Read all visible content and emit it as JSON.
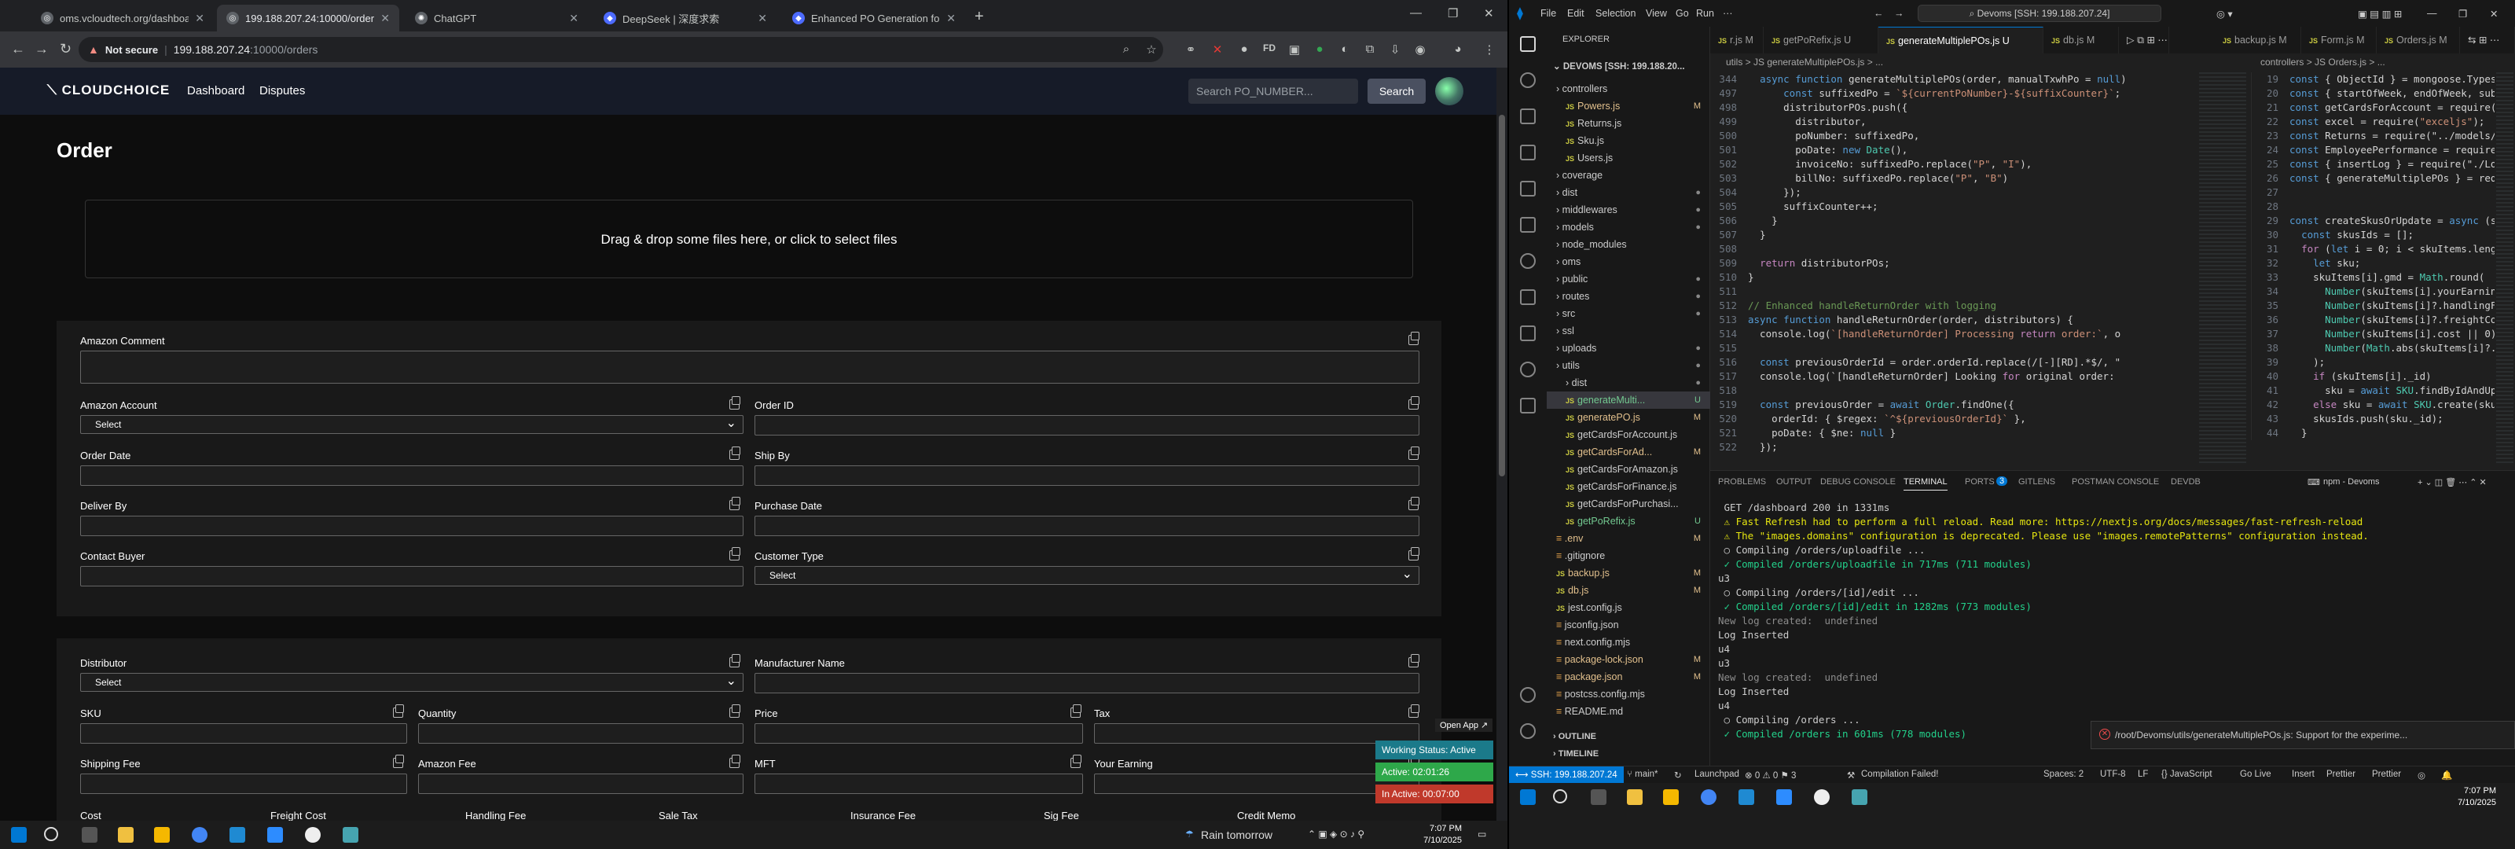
{
  "browser": {
    "tabs": [
      {
        "title": "oms.vcloudtech.org/dashboard",
        "fav": "◎"
      },
      {
        "title": "199.188.207.24:10000/orders",
        "fav": "◎"
      },
      {
        "title": "ChatGPT",
        "fav": "✺"
      },
      {
        "title": "DeepSeek | 深度求索",
        "fav": "◆"
      },
      {
        "title": "Enhanced PO Generation for M",
        "fav": "◆"
      }
    ],
    "url_security": "Not secure",
    "url_host": "199.188.207.24",
    "url_path": ":10000/orders"
  },
  "site": {
    "logo": "CLOUDCHOICE",
    "nav": [
      "Dashboard",
      "Disputes"
    ],
    "search_placeholder": "Search PO_NUMBER...",
    "search_button": "Search"
  },
  "form": {
    "title": "Order",
    "dropzone": "Drag & drop some files here, or click to select files",
    "amazon_comment": "Amazon Comment",
    "amazon_account": "Amazon Account",
    "order_id": "Order ID",
    "order_date": "Order Date",
    "ship_by": "Ship By",
    "deliver_by": "Deliver By",
    "purchase_date": "Purchase Date",
    "contact_buyer": "Contact Buyer",
    "customer_type": "Customer Type",
    "distributor": "Distributor",
    "manufacturer_name": "Manufacturer Name",
    "sku": "SKU",
    "quantity": "Quantity",
    "price": "Price",
    "tax": "Tax",
    "shipping_fee": "Shipping Fee",
    "amazon_fee": "Amazon Fee",
    "mft": "MFT",
    "your_earning": "Your Earning",
    "cost": "Cost",
    "freight_cost": "Freight Cost",
    "handling_fee": "Handling Fee",
    "sale_tax": "Sale Tax",
    "insurance_fee": "Insurance Fee",
    "sig_fee": "Sig Fee",
    "credit_memo": "Credit Memo",
    "select": "Select"
  },
  "overlay": {
    "open_app": "Open App ↗",
    "working_status": "Working Status: Active",
    "active": "Active: 02:01:26",
    "inactive": "In Active: 00:07:00",
    "colors": {
      "working": "#1b7a8a",
      "active": "#2ea84a",
      "inactive": "#c0392b"
    }
  },
  "win_taskbar_left": {
    "weather": "Rain tomorrow",
    "time": "7:07 PM",
    "date": "7/10/2025"
  },
  "vscode": {
    "menu": [
      "File",
      "Edit",
      "Selection",
      "View",
      "Go",
      "Run",
      "···"
    ],
    "command_center": "Devoms [SSH: 199.188.207.24]",
    "explorer_label": "EXPLORER",
    "root": "DEVOMS [SSH: 199.188.20...",
    "tree": [
      {
        "name": "controllers",
        "indent": 1,
        "folder": true,
        "mark": ""
      },
      {
        "name": "Powers.js",
        "indent": 2,
        "js": true,
        "mark": "M"
      },
      {
        "name": "Returns.js",
        "indent": 2,
        "js": true,
        "mark": ""
      },
      {
        "name": "Sku.js",
        "indent": 2,
        "js": true,
        "mark": ""
      },
      {
        "name": "Users.js",
        "indent": 2,
        "js": true,
        "mark": ""
      },
      {
        "name": "coverage",
        "indent": 1,
        "folder": true,
        "mark": ""
      },
      {
        "name": "dist",
        "indent": 1,
        "folder": true,
        "mark": "●"
      },
      {
        "name": "middlewares",
        "indent": 1,
        "folder": true,
        "mark": "●"
      },
      {
        "name": "models",
        "indent": 1,
        "folder": true,
        "mark": "●"
      },
      {
        "name": "node_modules",
        "indent": 1,
        "folder": true,
        "mark": ""
      },
      {
        "name": "oms",
        "indent": 1,
        "folder": true,
        "mark": ""
      },
      {
        "name": "public",
        "indent": 1,
        "folder": true,
        "mark": "●"
      },
      {
        "name": "routes",
        "indent": 1,
        "folder": true,
        "mark": "●"
      },
      {
        "name": "src",
        "indent": 1,
        "folder": true,
        "mark": "●"
      },
      {
        "name": "ssl",
        "indent": 1,
        "folder": true,
        "mark": ""
      },
      {
        "name": "uploads",
        "indent": 1,
        "folder": true,
        "mark": "●"
      },
      {
        "name": "utils",
        "indent": 1,
        "folder": true,
        "mark": "●"
      },
      {
        "name": "dist",
        "indent": 2,
        "folder": true,
        "mark": "●"
      },
      {
        "name": "generateMulti...",
        "indent": 2,
        "js": true,
        "mark": "U",
        "selected": true
      },
      {
        "name": "generatePO.js",
        "indent": 2,
        "js": true,
        "mark": "M"
      },
      {
        "name": "getCardsForAccount.js",
        "indent": 2,
        "js": true,
        "mark": ""
      },
      {
        "name": "getCardsForAd...",
        "indent": 2,
        "js": true,
        "mark": "M"
      },
      {
        "name": "getCardsForAmazon.js",
        "indent": 2,
        "js": true,
        "mark": ""
      },
      {
        "name": "getCardsForFinance.js",
        "indent": 2,
        "js": true,
        "mark": ""
      },
      {
        "name": "getCardsForPurchasi...",
        "indent": 2,
        "js": true,
        "mark": ""
      },
      {
        "name": "getPoRefix.js",
        "indent": 2,
        "js": true,
        "mark": "U"
      },
      {
        "name": ".env",
        "indent": 1,
        "js": false,
        "mark": "M"
      },
      {
        "name": ".gitignore",
        "indent": 1,
        "js": false,
        "mark": ""
      },
      {
        "name": "backup.js",
        "indent": 1,
        "js": true,
        "mark": "M"
      },
      {
        "name": "db.js",
        "indent": 1,
        "js": true,
        "mark": "M"
      },
      {
        "name": "jest.config.js",
        "indent": 1,
        "js": true,
        "mark": ""
      },
      {
        "name": "jsconfig.json",
        "indent": 1,
        "js": false,
        "mark": ""
      },
      {
        "name": "next.config.mjs",
        "indent": 1,
        "js": false,
        "mark": ""
      },
      {
        "name": "package-lock.json",
        "indent": 1,
        "js": false,
        "mark": "M"
      },
      {
        "name": "package.json",
        "indent": 1,
        "js": false,
        "mark": "M"
      },
      {
        "name": "postcss.config.mjs",
        "indent": 1,
        "js": false,
        "mark": ""
      },
      {
        "name": "README.md",
        "indent": 1,
        "js": false,
        "mark": ""
      }
    ],
    "outline": "OUTLINE",
    "timeline": "TIMELINE",
    "editor_tabs": [
      "r.js M",
      "getPoRefix.js U",
      "generateMultiplePOs.js U",
      "db.js M",
      "backup.js M",
      "Form.js M",
      "Orders.js M"
    ],
    "crumbs_left": "utils > JS generateMultiplePOs.js > ...",
    "crumbs_right": "controllers > JS Orders.js > ...",
    "left_lines": [
      {
        "n": "344",
        "t": "  async function generateMultiplePOs(order, manualTxwhPo = null)"
      },
      {
        "n": "497",
        "t": "      const suffixedPo = `${currentPoNumber}-${suffixCounter}`;"
      },
      {
        "n": "498",
        "t": "      distributorPOs.push({"
      },
      {
        "n": "499",
        "t": "        distributor,"
      },
      {
        "n": "500",
        "t": "        poNumber: suffixedPo,"
      },
      {
        "n": "501",
        "t": "        poDate: new Date(),"
      },
      {
        "n": "502",
        "t": "        invoiceNo: suffixedPo.replace(\"P\", \"I\"),"
      },
      {
        "n": "503",
        "t": "        billNo: suffixedPo.replace(\"P\", \"B\")"
      },
      {
        "n": "504",
        "t": "      });"
      },
      {
        "n": "505",
        "t": "      suffixCounter++;"
      },
      {
        "n": "506",
        "t": "    }"
      },
      {
        "n": "507",
        "t": "  }"
      },
      {
        "n": "508",
        "t": ""
      },
      {
        "n": "509",
        "t": "  return distributorPOs;"
      },
      {
        "n": "510",
        "t": "}"
      },
      {
        "n": "511",
        "t": ""
      },
      {
        "n": "512",
        "t": "// Enhanced handleReturnOrder with logging"
      },
      {
        "n": "513",
        "t": "async function handleReturnOrder(order, distributors) {"
      },
      {
        "n": "514",
        "t": "  console.log(`[handleReturnOrder] Processing return order:`, o"
      },
      {
        "n": "515",
        "t": ""
      },
      {
        "n": "516",
        "t": "  const previousOrderId = order.orderId.replace(/[-][RD].*$/, \""
      },
      {
        "n": "517",
        "t": "  console.log(`[handleReturnOrder] Looking for original order:"
      },
      {
        "n": "518",
        "t": ""
      },
      {
        "n": "519",
        "t": "  const previousOrder = await Order.findOne({"
      },
      {
        "n": "520",
        "t": "    orderId: { $regex: `^${previousOrderId}` },"
      },
      {
        "n": "521",
        "t": "    poDate: { $ne: null }"
      },
      {
        "n": "522",
        "t": "  });"
      }
    ],
    "right_lines": [
      {
        "n": "19",
        "t": "const { ObjectId } = mongoose.Types;"
      },
      {
        "n": "20",
        "t": "const { startOfWeek, endOfWeek, subWe"
      },
      {
        "n": "21",
        "t": "const getCardsForAccount = require(\"."
      },
      {
        "n": "22",
        "t": "const excel = require(\"exceljs\");"
      },
      {
        "n": "23",
        "t": "const Returns = require(\"../models/Re"
      },
      {
        "n": "24",
        "t": "const EmployeePerformance = require(\""
      },
      {
        "n": "25",
        "t": "const { insertLog } = require(\"./Log"
      },
      {
        "n": "26",
        "t": "const { generateMultiplePOs } = requi"
      },
      {
        "n": "27",
        "t": ""
      },
      {
        "n": "28",
        "t": ""
      },
      {
        "n": "29",
        "t": "const createSkusOrUpdate = async (sku"
      },
      {
        "n": "30",
        "t": "  const skusIds = [];"
      },
      {
        "n": "31",
        "t": "  for (let i = 0; i < skuItems.length"
      },
      {
        "n": "32",
        "t": "    let sku;"
      },
      {
        "n": "33",
        "t": "    skuItems[i].gmd = Math.round("
      },
      {
        "n": "34",
        "t": "      Number(skuItems[i].yourEarnin"
      },
      {
        "n": "35",
        "t": "      Number(skuItems[i]?.handlingFe"
      },
      {
        "n": "36",
        "t": "      Number(skuItems[i]?.freightCos"
      },
      {
        "n": "37",
        "t": "      Number(skuItems[i].cost || 0)"
      },
      {
        "n": "38",
        "t": "      Number(Math.abs(skuItems[i]?.ct"
      },
      {
        "n": "39",
        "t": "    );"
      },
      {
        "n": "40",
        "t": "    if (skuItems[i]._id)"
      },
      {
        "n": "41",
        "t": "      sku = await SKU.findByIdAndUpd"
      },
      {
        "n": "42",
        "t": "    else sku = await SKU.create(skuI"
      },
      {
        "n": "43",
        "t": "    skusIds.push(sku._id);"
      },
      {
        "n": "44",
        "t": "  }"
      }
    ],
    "panel_tabs": [
      "PROBLEMS",
      "OUTPUT",
      "DEBUG CONSOLE",
      "TERMINAL",
      "PORTS",
      "GITLENS",
      "POSTMAN CONSOLE",
      "DEVDB"
    ],
    "ports_count": "3",
    "terminal_label": "npm - Devoms",
    "terminal_lines": [
      {
        "t": " GET /dashboard 200 in 1331ms",
        "c": ""
      },
      {
        "t": " ⚠ Fast Refresh had to perform a full reload. Read more: https://nextjs.org/docs/messages/fast-refresh-reload",
        "c": "warn"
      },
      {
        "t": " ⚠ The \"images.domains\" configuration is deprecated. Please use \"images.remotePatterns\" configuration instead.",
        "c": "warn"
      },
      {
        "t": " ○ Compiling /orders/uploadfile ...",
        "c": ""
      },
      {
        "t": " ✓ Compiled /orders/uploadfile in 717ms (711 modules)",
        "c": "ok"
      },
      {
        "t": "u3",
        "c": ""
      },
      {
        "t": " ○ Compiling /orders/[id]/edit ...",
        "c": ""
      },
      {
        "t": " ✓ Compiled /orders/[id]/edit in 1282ms (773 modules)",
        "c": "ok"
      },
      {
        "t": "New log created:  undefined",
        "c": "grey"
      },
      {
        "t": "Log Inserted",
        "c": ""
      },
      {
        "t": "u4",
        "c": ""
      },
      {
        "t": "u3",
        "c": ""
      },
      {
        "t": "New log created:  undefined",
        "c": "grey"
      },
      {
        "t": "Log Inserted",
        "c": ""
      },
      {
        "t": "u4",
        "c": ""
      },
      {
        "t": " ○ Compiling /orders ...",
        "c": ""
      },
      {
        "t": " ✓ Compiled /orders in 601ms (778 modules)",
        "c": "ok"
      }
    ],
    "notification": "/root/Devoms/utils/generateMultiplePOs.js: Support for the experime...",
    "status": {
      "remote": "SSH: 199.188.207.24",
      "branch": "main*",
      "launchpad": "Launchpad",
      "problems": "⊗ 0  ⚠ 0  ⚑ 3",
      "compile": "Compilation Failed!",
      "spaces": "Spaces: 2",
      "encoding": "UTF-8",
      "eol": "LF",
      "lang": "{} JavaScript",
      "golive": "Go Live",
      "insert": "Insert",
      "prettier1": "Prettier",
      "prettier2": "Prettier"
    },
    "time": "7:07 PM",
    "date": "7/10/2025"
  }
}
